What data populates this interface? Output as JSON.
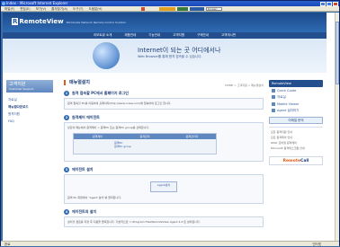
{
  "window": {
    "title": "Index - Microsoft Internet Explorer"
  },
  "menu": [
    "파일(F)",
    "편집(E)",
    "보기(V)",
    "즐겨찾기(A)",
    "도구(T)",
    "도움말(H)"
  ],
  "toolbar": {
    "search_value": "Korean"
  },
  "site": {
    "logo_text": "RemoteView",
    "logo_tagline": "Worldwide Network Remote Control Solution",
    "nav": [
      "리모트뷰 소개",
      "제품안내",
      "기능안내",
      "고객지원",
      "구매안내",
      "고객게시판"
    ],
    "banner_title": "Internet이 되는 곳 어디에서나",
    "banner_sub": "Web Browser를 통해 원격 접속을 수 있습니다."
  },
  "left_nav": {
    "title": "고객지원",
    "subtitle": "Customer Support",
    "items": [
      "자료실",
      "매뉴얼다운로드",
      "원격지원",
      "FAQ"
    ]
  },
  "main": {
    "page_title": "매뉴얼설치",
    "breadcrumb": "HOME > 고객지원 > 매뉴얼설치",
    "sections": [
      {
        "num": "1",
        "title": "원격 접속할 PC에서 홈페이지 로그인",
        "text": "원격 접속할 PC를 이용하여 홈페이지(http://www.rview.com)에 접속하여 로그인 합니다."
      },
      {
        "num": "2",
        "title": "원격제어 에이전트",
        "text": "상단의 메뉴에서 원격제어 > 원격PC 또는 원격PC group를 선택합니다."
      },
      {
        "num": "3",
        "title": "에이전트 설치",
        "text": "원격 PC 화면에서 \"Agent 설치\"를 클릭합니다."
      },
      {
        "num": "4",
        "title": "에이전트의 설치",
        "text": "설치할 경로를 지정 후 다음을 클릭합니다. 기본적으로 'c:\\Program Files\\RemoteView Agent 4.0'로 설치됩니다."
      }
    ],
    "table_headers": [
      "원격제어",
      "원격관리",
      "원격관리자"
    ],
    "table_rows": [
      "원격PC",
      "원격PC group"
    ],
    "agent_button": "Agent설치"
  },
  "right": {
    "header": "RemoteView",
    "items": [
      "Quick Guide",
      "자료실",
      "Mobile Viewer",
      "Agent 설치하기"
    ],
    "button": "이메일 문의",
    "links": [
      "모든 원격지원 안내",
      "모든 원격제어 안내",
      "ONLY 모바일 원격제어",
      "Microsoft 원격데스크톱 안내"
    ],
    "logo_a": "Remote",
    "logo_b": "Call"
  },
  "status": {
    "left": "완료",
    "zone": "인터넷"
  }
}
